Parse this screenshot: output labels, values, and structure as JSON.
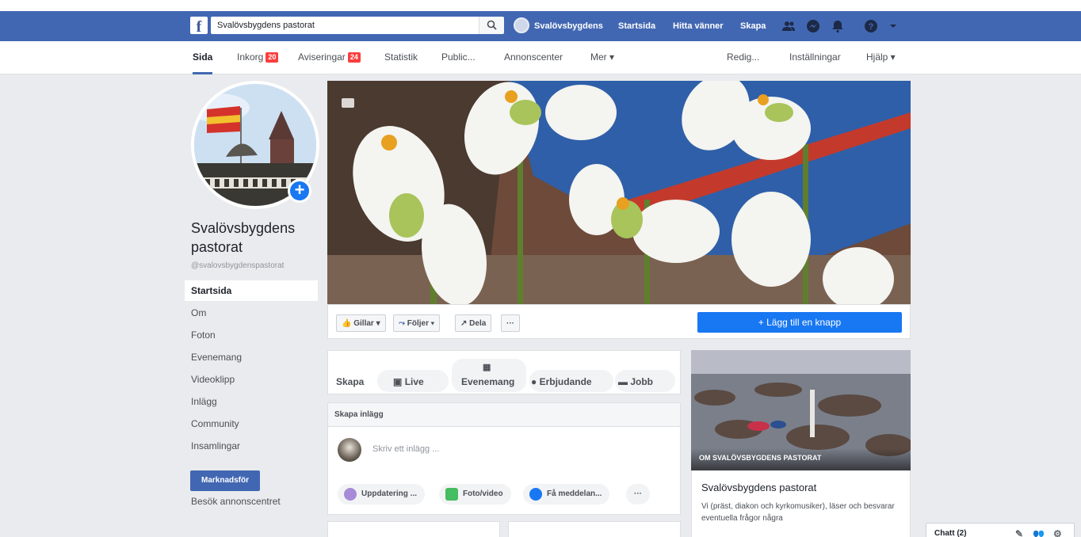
{
  "topbar": {
    "search_value": "Svalövsbygdens pastorat",
    "profile_name": "Svalövsbygdens",
    "nav_items": [
      "Startsida",
      "Hitta vänner",
      "Skapa"
    ]
  },
  "subnav": {
    "items": [
      {
        "label": "Sida",
        "badge": ""
      },
      {
        "label": "Inkorg",
        "badge": "20"
      },
      {
        "label": "Aviseringar",
        "badge": "24"
      },
      {
        "label": "Statistik",
        "badge": ""
      },
      {
        "label": "Public...",
        "badge": ""
      },
      {
        "label": "Annonscenter",
        "badge": ""
      },
      {
        "label": "Mer ▾",
        "badge": ""
      }
    ],
    "right_items": [
      "Redig...",
      "Inställningar",
      "Hjälp ▾"
    ]
  },
  "page": {
    "name": "Svalövsbygdens pastorat",
    "handle": "@svalovsbygdenspastorat"
  },
  "left_nav": [
    "Startsida",
    "Om",
    "Foton",
    "Evenemang",
    "Videoklipp",
    "Inlägg",
    "Community",
    "Insamlingar"
  ],
  "promote_label": "Marknadsför",
  "ad_center_label": "Besök annonscentret",
  "actions": {
    "like": "Gillar ▾",
    "follow": "Följer ▾",
    "share": "Dela",
    "more": "···",
    "cta": "+ Lägg till en knapp"
  },
  "create": {
    "label": "Skapa",
    "items": [
      "Live",
      "Evenemang",
      "Erbjudande",
      "Jobb"
    ]
  },
  "composer": {
    "header": "Skapa inlägg",
    "placeholder": "Skriv ett inlägg ...",
    "pills": [
      "Uppdatering ...",
      "Foto/video",
      "Få meddelan...",
      "···"
    ]
  },
  "about": {
    "caption": "OM SVALÖVSBYGDENS PASTORAT",
    "title": "Svalövsbygdens pastorat",
    "text": "Vi (präst, diakon och kyrkomusiker), läser och besvarar eventuella frågor några"
  },
  "chat": {
    "label": "Chatt (2)"
  },
  "colors": {
    "brand": "#4267b2",
    "cta": "#1877f2",
    "badge": "#fa3e3e"
  }
}
